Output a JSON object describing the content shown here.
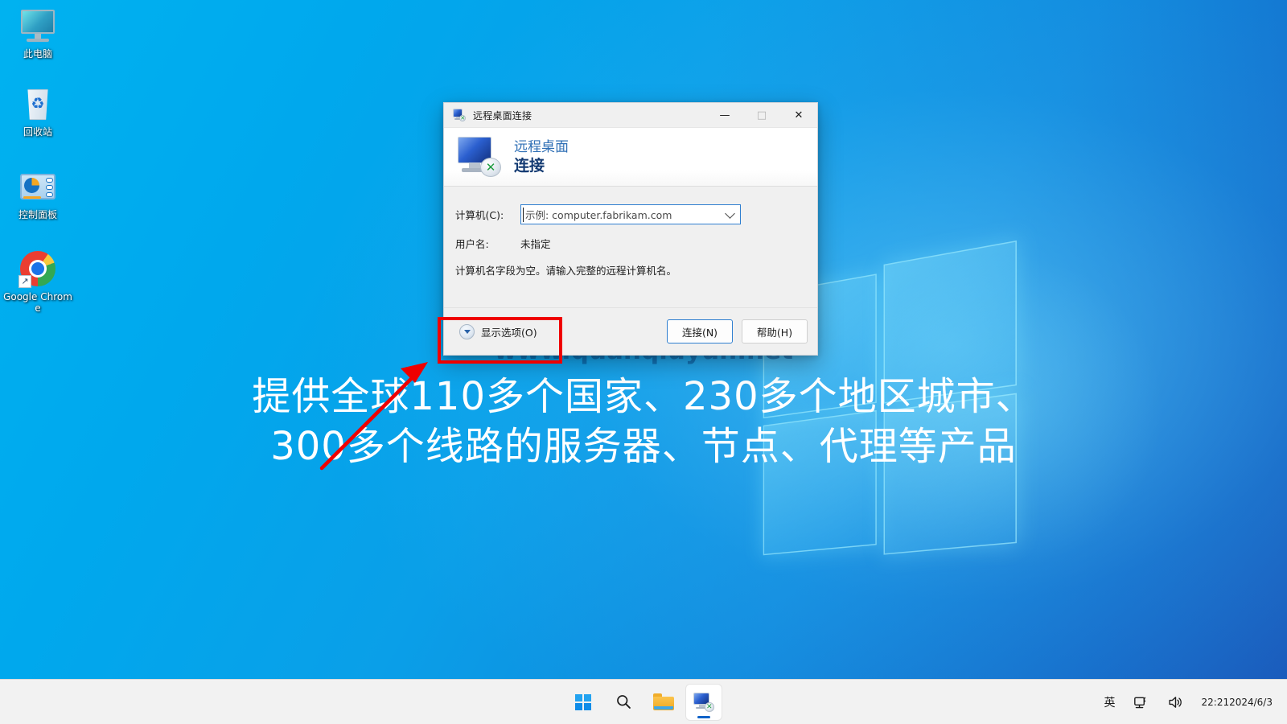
{
  "desktop": {
    "icons": [
      {
        "name": "this-pc",
        "label": "此电脑"
      },
      {
        "name": "recycle-bin",
        "label": "回收站"
      },
      {
        "name": "control-panel",
        "label": "控制面板"
      },
      {
        "name": "google-chrome",
        "label": "Google Chrome"
      }
    ],
    "watermark": "www.quanqiuyun.net",
    "overlay_text": "提供全球110多个国家、230多个地区城市、\n300多个线路的服务器、节点、代理等产品",
    "annotation_color": "#ef0000"
  },
  "rdp": {
    "titlebar": {
      "title": "远程桌面连接",
      "icon": "remote-desktop-icon",
      "minimize": "—",
      "maximize": "□",
      "close": "✕"
    },
    "header": {
      "line1": "远程桌面",
      "line2": "连接"
    },
    "form": {
      "computer_label": "计算机(C):",
      "computer_accel": "C",
      "computer_placeholder": "示例: computer.fabrikam.com",
      "computer_value": "",
      "username_label": "用户名:",
      "username_value": "未指定",
      "hint": "计算机名字段为空。请输入完整的远程计算机名。"
    },
    "footer": {
      "show_options": "显示选项(O)",
      "connect": "连接(N)",
      "help": "帮助(H)"
    }
  },
  "taskbar": {
    "start": "start-button",
    "search": "search-button",
    "file_explorer": "file-explorer-button",
    "rdp_task": "remote-desktop-taskbar-button",
    "tray": {
      "ime": "英",
      "network": "network-icon",
      "volume": "volume-icon",
      "time": "22:21",
      "date": "2024/6/3"
    }
  }
}
